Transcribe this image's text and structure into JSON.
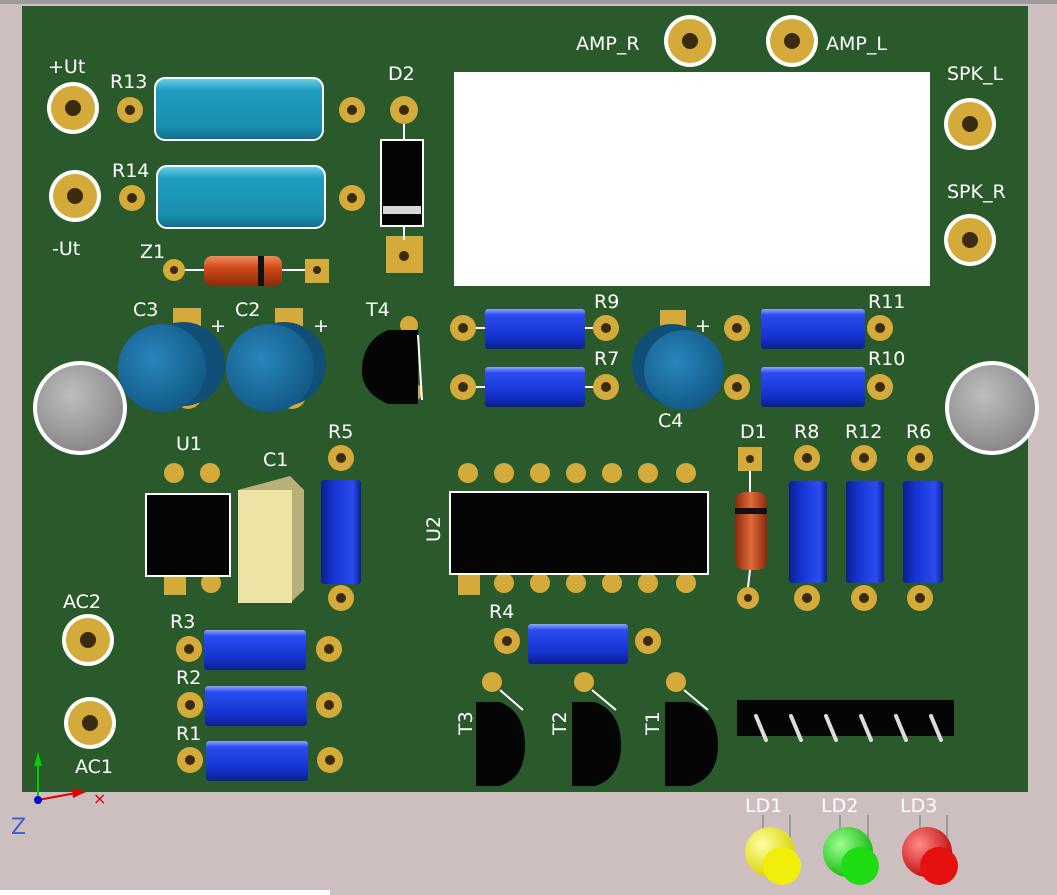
{
  "colors": {
    "background": "#cdbfbf",
    "board": "#2a5a2c",
    "pad_copper": "#d4aa3a",
    "silkscreen": "#ffffff",
    "resistor_blue": "#1433d0",
    "resistor_teal": "#1a8fb0",
    "electrolytic_cap": "#1a70a6",
    "ic_body": "#050505",
    "film_cap": "#ece3a5",
    "zener_orange": "#cf4a1a",
    "led_yellow": "#f2ee0c",
    "led_green": "#1ddc12",
    "led_red": "#e51010"
  },
  "labels": {
    "plus_ut": "+Ut",
    "minus_ut": "-Ut",
    "r13": "R13",
    "r14": "R14",
    "d2": "D2",
    "z1": "Z1",
    "amp_r": "AMP_R",
    "amp_l": "AMP_L",
    "spk_l": "SPK_L",
    "spk_r": "SPK_R",
    "c3": "C3",
    "c2": "C2",
    "t4": "T4",
    "r9": "R9",
    "r7": "R7",
    "c4": "C4",
    "r11": "R11",
    "r10": "R10",
    "u1": "U1",
    "c1": "C1",
    "r5": "R5",
    "u2": "U2",
    "d1": "D1",
    "r8": "R8",
    "r12": "R12",
    "r6": "R6",
    "ac2": "AC2",
    "ac1": "AC1",
    "r3": "R3",
    "r2": "R2",
    "r1": "R1",
    "r4": "R4",
    "t3": "T3",
    "t2": "T2",
    "t1": "T1",
    "ld1": "LD1",
    "ld2": "LD2",
    "ld3": "LD3",
    "plus": "+"
  },
  "axis_triad": {
    "z_label": "Z"
  }
}
